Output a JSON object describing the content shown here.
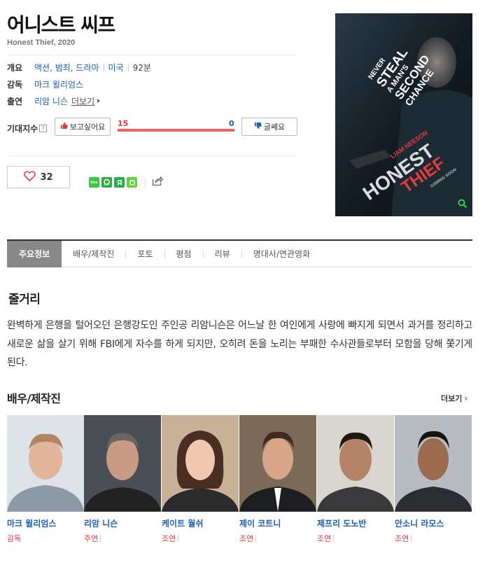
{
  "movie": {
    "title": "어니스트 씨프",
    "subtitle": "Honest Thief, 2020"
  },
  "overview": {
    "label": "개요",
    "genres": "액션, 범죄, 드라마",
    "country": "미국",
    "runtime": "92분"
  },
  "director": {
    "label": "감독",
    "name": "마크 윌리엄스"
  },
  "cast_row": {
    "label": "출연",
    "name": "리암 니슨",
    "more": "더보기"
  },
  "expect": {
    "label": "기대지수",
    "help": "?",
    "want_label": "보고싶어요",
    "no_label": "글쎄요",
    "want_count": "15",
    "no_count": "0",
    "want_fraction": 1.0
  },
  "like": {
    "count": "32"
  },
  "share_icons": [
    "line-icon",
    "band-icon",
    "blog-icon",
    "cafe-icon",
    "share-icon"
  ],
  "poster": {
    "tagline": [
      "NEVER",
      "STEAL",
      "A MAN'S",
      "SECOND",
      "CHANCE"
    ],
    "actor": "LIAM NEESON",
    "title_a": "HONEST",
    "title_b": "THIEF",
    "coming": "COMING SOON"
  },
  "tabs": [
    "주요정보",
    "배우/제작진",
    "포토",
    "평점",
    "리뷰",
    "명대사/연관영화"
  ],
  "synopsis": {
    "title": "줄거리",
    "text": "완벽하게 은행을 털어오던 은행강도인 주인공 리암니슨은 어느날 한 여인에게 사랑에 빠지게 되면서 과거를 정리하고 새로운 삶을 살기 위해 FBI에게 자수를 하게 되지만, 오히려 돈을 노리는 부패한 수사관들로부터 모함을 당해 쫓기게 된다."
  },
  "cast_section": {
    "title": "배우/제작진",
    "more": "더보기",
    "people": [
      {
        "name": "마크 윌리엄스",
        "role": "감독"
      },
      {
        "name": "리암 니슨",
        "role": "주연"
      },
      {
        "name": "케이트 월쉬",
        "role": "조연"
      },
      {
        "name": "제이 코트니",
        "role": "조연"
      },
      {
        "name": "제프리 도노반",
        "role": "조연"
      },
      {
        "name": "안소니 라모스",
        "role": "조연"
      }
    ]
  },
  "colors": {
    "link": "#1a5fb4",
    "red": "#e2353e",
    "tab_active_bg": "#888888"
  }
}
